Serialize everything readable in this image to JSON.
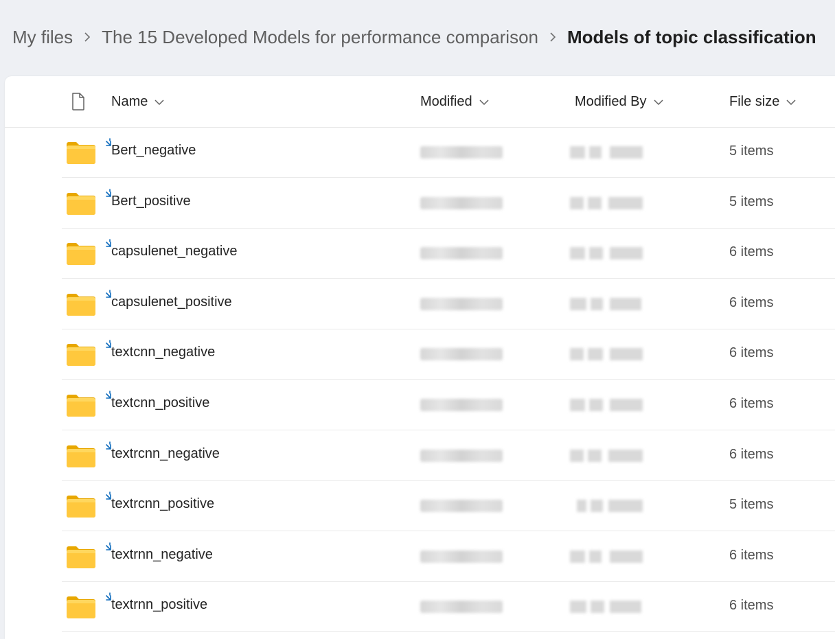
{
  "breadcrumb": {
    "items": [
      "My files",
      "The 15 Developed Models for performance comparison",
      "Models of topic classification"
    ]
  },
  "columns": {
    "name": "Name",
    "modified": "Modified",
    "modified_by": "Modified By",
    "file_size": "File size"
  },
  "rows": [
    {
      "name": "Bert_negative",
      "size": "5 items"
    },
    {
      "name": "Bert_positive",
      "size": "5 items"
    },
    {
      "name": "capsulenet_negative",
      "size": "6 items"
    },
    {
      "name": "capsulenet_positive",
      "size": "6 items"
    },
    {
      "name": "textcnn_negative",
      "size": "6 items"
    },
    {
      "name": "textcnn_positive",
      "size": "6 items"
    },
    {
      "name": "textrcnn_negative",
      "size": "6 items"
    },
    {
      "name": "textrcnn_positive",
      "size": "5 items"
    },
    {
      "name": "textrnn_negative",
      "size": "6 items"
    },
    {
      "name": "textrnn_positive",
      "size": "6 items"
    }
  ],
  "icons": {
    "folder": "folder-icon",
    "shared": "shared-indicator-icon",
    "file_type": "file-type-icon",
    "sort": "chevron-down-icon",
    "separator": "chevron-right-icon"
  },
  "colors": {
    "folder": "#f8c21c",
    "shared_indicator": "#0f6cbd",
    "background": "#eef0f4"
  }
}
